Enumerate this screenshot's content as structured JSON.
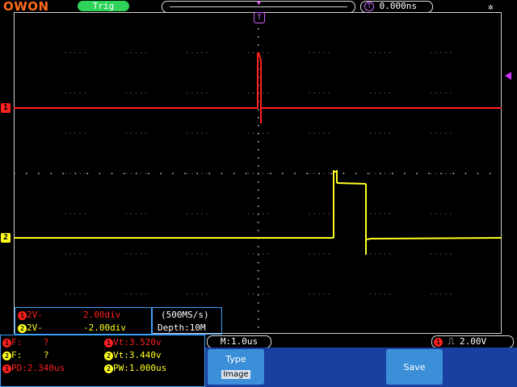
{
  "brand": {
    "logo_text": "OWON"
  },
  "top_bar": {
    "trigger_state": "Trig",
    "time_offset": "0.000ns",
    "trigger_icon": "T"
  },
  "channels": {
    "ch1": {
      "marker": "1",
      "color": "#ff2020",
      "info": "2V-",
      "scale": "2.00div"
    },
    "ch2": {
      "marker": "2",
      "color": "#ffff20",
      "info": "2V-",
      "scale": "-2.00div"
    }
  },
  "acquisition": {
    "sample_rate": "(500MS/s)",
    "depth": "Depth:10M"
  },
  "measurements": {
    "row1_left_label": "F:",
    "row1_left_value": "?",
    "row1_right_label": "Vt:3.520v",
    "row2_left_label": "F:",
    "row2_left_value": "?",
    "row2_right_label": "Vt:3.440v",
    "row3_left_label": "PD:2.340us",
    "row3_right_label": "PW:1.000us"
  },
  "timebase": {
    "label": "M:1.0us"
  },
  "trigger": {
    "channel": "1",
    "edge_icon": "rising-edge-icon",
    "level": "2.00V"
  },
  "menu": {
    "type_label": "Type",
    "type_value": "Image",
    "save_label": "Save"
  }
}
